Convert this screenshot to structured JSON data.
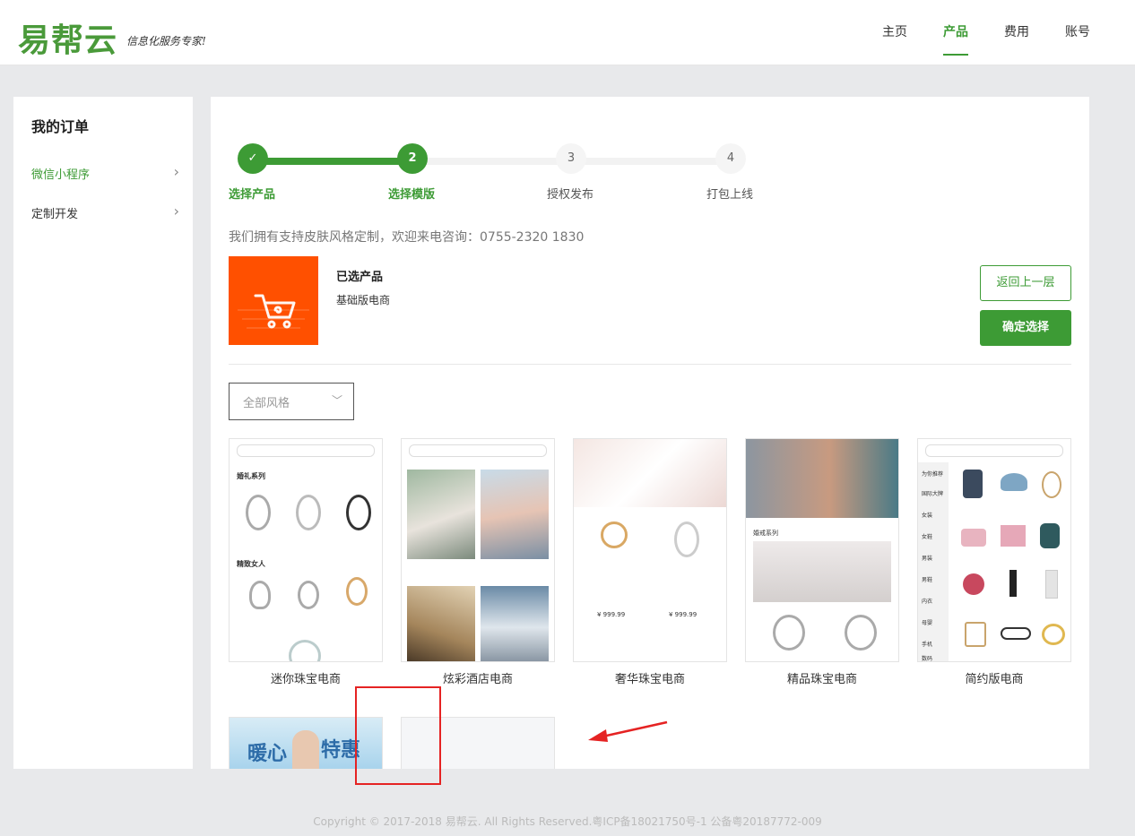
{
  "header": {
    "logo_text": "易帮云",
    "slogan": "信息化服务专家!",
    "nav": [
      {
        "label": "主页",
        "active": false
      },
      {
        "label": "产品",
        "active": true
      },
      {
        "label": "费用",
        "active": false
      },
      {
        "label": "账号",
        "active": false
      }
    ]
  },
  "sidebar": {
    "title": "我的订单",
    "items": [
      {
        "label": "微信小程序",
        "active": true
      },
      {
        "label": "定制开发",
        "active": false
      }
    ]
  },
  "steps": [
    {
      "num": "✓",
      "label": "选择产品",
      "state": "done"
    },
    {
      "num": "2",
      "label": "选择模版",
      "state": "current"
    },
    {
      "num": "3",
      "label": "授权发布",
      "state": "todo"
    },
    {
      "num": "4",
      "label": "打包上线",
      "state": "todo"
    }
  ],
  "hint": "我们拥有支持皮肤风格定制，欢迎来电咨询：0755-2320 1830",
  "product": {
    "title": "已选产品",
    "name": "基础版电商"
  },
  "buttons": {
    "back": "返回上一层",
    "confirm": "确定选择"
  },
  "filter": {
    "value": "全部风格"
  },
  "templates": [
    {
      "name": "迷你珠宝电商"
    },
    {
      "name": "炫彩酒店电商"
    },
    {
      "name": "奢华珠宝电商"
    },
    {
      "name": "精品珠宝电商"
    },
    {
      "name": "简约版电商"
    }
  ],
  "template_row2": {
    "banner_text_1": "暖心",
    "banner_text_2": "特惠"
  },
  "mock_text": {
    "t1_sec1": "婚礼系列",
    "t1_sec2": "精致女人",
    "t4_sec": "婚戒系列",
    "t5_side": [
      "为你推荐",
      "国际大牌",
      "女装",
      "女鞋",
      "男装",
      "男鞋",
      "内衣",
      "母婴",
      "手机",
      "数码"
    ],
    "t3_price": "¥ 999.99"
  },
  "footer": "Copyright © 2017-2018 易帮云. All Rights Reserved.粤ICP备18021750号-1 公备粤20187772-009",
  "colors": {
    "accent": "#3d9b35",
    "product_icon_bg": "#ff5000",
    "annotation": "#e52323"
  }
}
